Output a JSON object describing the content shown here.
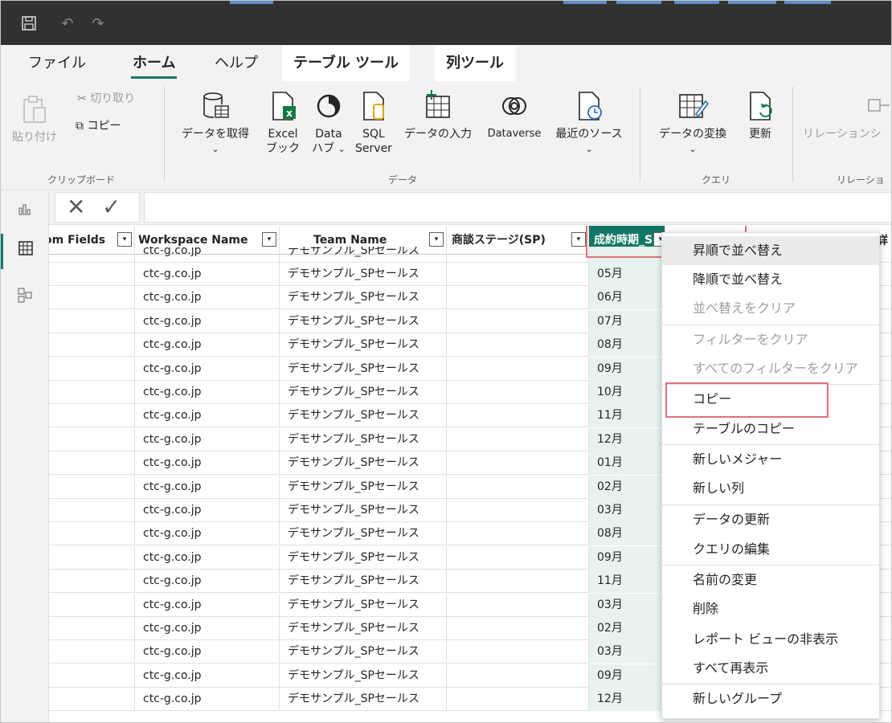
{
  "titlebar": {
    "save_icon": "save-icon",
    "undo_icon": "undo-icon",
    "redo_icon": "redo-icon"
  },
  "tabs": {
    "file": "ファイル",
    "home": "ホーム",
    "help": "ヘルプ",
    "table_tools": "テーブル ツール",
    "column_tools": "列ツール"
  },
  "ribbon": {
    "clipboard": {
      "paste": "貼り付け",
      "cut": "切り取り",
      "copy": "コピー",
      "label": "クリップボード"
    },
    "data": {
      "get_data": "データを取得",
      "excel_l1": "Excel",
      "excel_l2": "ブック",
      "hub_l1": "Data",
      "hub_l2": "ハブ",
      "sql_l1": "SQL",
      "sql_l2": "Server",
      "enter_data": "データの入力",
      "dataverse": "Dataverse",
      "recent": "最近のソース",
      "label": "データ"
    },
    "query": {
      "transform": "データの変換",
      "refresh": "更新",
      "label": "クエリ"
    },
    "relationships": {
      "manage": "リレーションシ",
      "label": "リレーショ"
    }
  },
  "formula_bar": {
    "cancel": "✕",
    "commit": "✓"
  },
  "grid": {
    "headers": [
      "om Fields",
      "Workspace Name",
      "Team Name",
      "商談ステージ(SP)",
      "成約時期_S"
    ],
    "partial_header_right": "詳",
    "partial_row": {
      "domain": "ctc-g.co.jp",
      "team": "デモサンプル_SPセールス"
    },
    "rows": [
      {
        "domain": "ctc-g.co.jp",
        "team": "デモサンプル_SPセールス",
        "month": "05月"
      },
      {
        "domain": "ctc-g.co.jp",
        "team": "デモサンプル_SPセールス",
        "month": "06月"
      },
      {
        "domain": "ctc-g.co.jp",
        "team": "デモサンプル_SPセールス",
        "month": "07月"
      },
      {
        "domain": "ctc-g.co.jp",
        "team": "デモサンプル_SPセールス",
        "month": "08月"
      },
      {
        "domain": "ctc-g.co.jp",
        "team": "デモサンプル_SPセールス",
        "month": "09月"
      },
      {
        "domain": "ctc-g.co.jp",
        "team": "デモサンプル_SPセールス",
        "month": "10月"
      },
      {
        "domain": "ctc-g.co.jp",
        "team": "デモサンプル_SPセールス",
        "month": "11月"
      },
      {
        "domain": "ctc-g.co.jp",
        "team": "デモサンプル_SPセールス",
        "month": "12月"
      },
      {
        "domain": "ctc-g.co.jp",
        "team": "デモサンプル_SPセールス",
        "month": "01月"
      },
      {
        "domain": "ctc-g.co.jp",
        "team": "デモサンプル_SPセールス",
        "month": "02月"
      },
      {
        "domain": "ctc-g.co.jp",
        "team": "デモサンプル_SPセールス",
        "month": "03月"
      },
      {
        "domain": "ctc-g.co.jp",
        "team": "デモサンプル_SPセールス",
        "month": "08月"
      },
      {
        "domain": "ctc-g.co.jp",
        "team": "デモサンプル_SPセールス",
        "month": "09月"
      },
      {
        "domain": "ctc-g.co.jp",
        "team": "デモサンプル_SPセールス",
        "month": "11月"
      },
      {
        "domain": "ctc-g.co.jp",
        "team": "デモサンプル_SPセールス",
        "month": "03月"
      },
      {
        "domain": "ctc-g.co.jp",
        "team": "デモサンプル_SPセールス",
        "month": "02月"
      },
      {
        "domain": "ctc-g.co.jp",
        "team": "デモサンプル_SPセールス",
        "month": "03月"
      },
      {
        "domain": "ctc-g.co.jp",
        "team": "デモサンプル_SPセールス",
        "month": "09月"
      },
      {
        "domain": "ctc-g.co.jp",
        "team": "デモサンプル_SPセールス",
        "month": "12月"
      }
    ]
  },
  "context_menu": {
    "items": [
      "昇順で並べ替え",
      "降順で並べ替え",
      "並べ替えをクリア",
      "フィルターをクリア",
      "すべてのフィルターをクリア",
      "コピー",
      "テーブルのコピー",
      "新しいメジャー",
      "新しい列",
      "データの更新",
      "クエリの編集",
      "名前の変更",
      "削除",
      "レポート ビューの非表示",
      "すべて再表示",
      "新しいグループ"
    ]
  },
  "colors": {
    "accent": "#117865",
    "highlight": "#e0707a",
    "titlebar": "#323130"
  }
}
